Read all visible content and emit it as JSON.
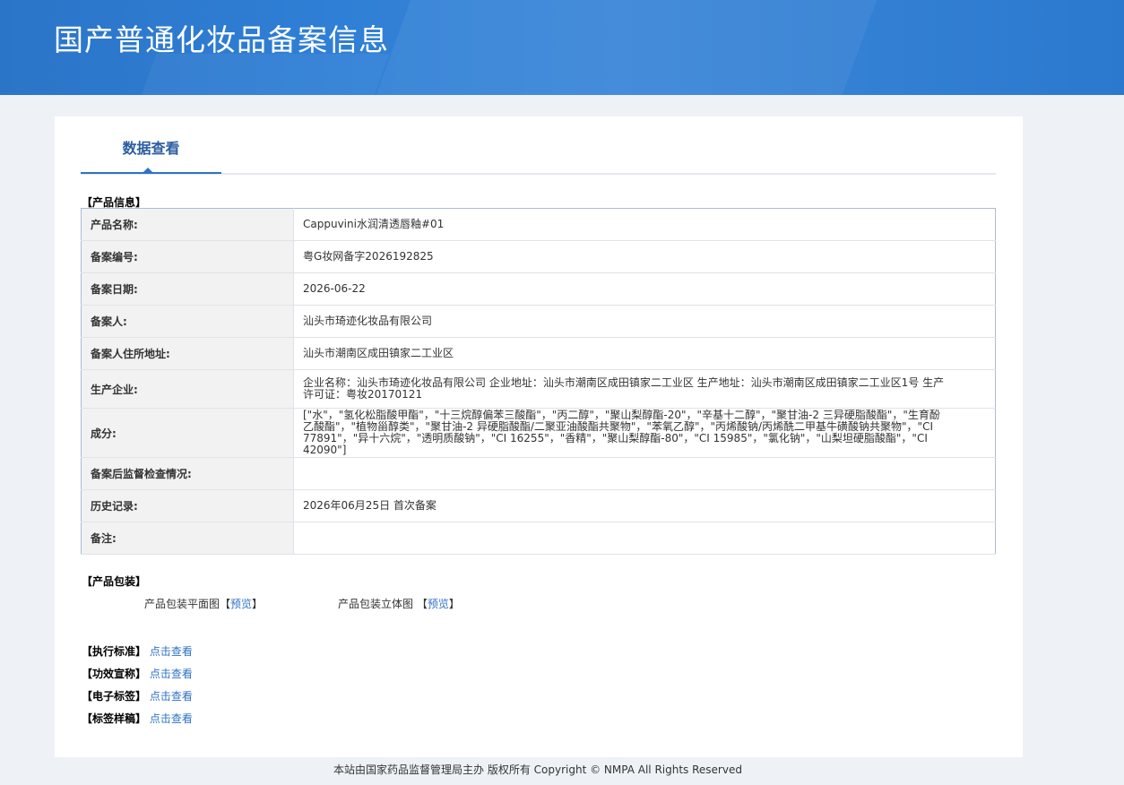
{
  "header": {
    "title": "国产普通化妆品备案信息"
  },
  "tab": {
    "label": "数据查看"
  },
  "product_info": {
    "section_title": "【产品信息】",
    "rows": [
      {
        "label": "产品名称:",
        "value": "Cappuvini水润清透唇釉#01"
      },
      {
        "label": "备案编号:",
        "value": "粤G妆网备字2026192825"
      },
      {
        "label": "备案日期:",
        "value": "2026-06-22"
      },
      {
        "label": "备案人:",
        "value": "汕头市琦迹化妆品有限公司"
      },
      {
        "label": "备案人住所地址:",
        "value": "汕头市潮南区成田镇家二工业区"
      },
      {
        "label": "生产企业:",
        "value": "企业名称：汕头市琦迹化妆品有限公司 企业地址：汕头市潮南区成田镇家二工业区 生产地址：汕头市潮南区成田镇家二工业区1号 生产许可证：粤妆20170121"
      },
      {
        "label": "成分:",
        "value": "[\"水\"，\"氢化松脂酸甲酯\"，\"十三烷醇偏苯三酸酯\"，\"丙二醇\"，\"聚山梨醇酯-20\"，\"辛基十二醇\"，\"聚甘油-2 三异硬脂酸酯\"，\"生育酚乙酸酯\"，\"植物甾醇类\"，\"聚甘油-2 异硬脂酸酯/二聚亚油酸酯共聚物\"，\"苯氧乙醇\"，\"丙烯酸钠/丙烯酰二甲基牛磺酸钠共聚物\"，\"CI 77891\"，\"异十六烷\"，\"透明质酸钠\"，\"CI 16255\"，\"香精\"，\"聚山梨醇酯-80\"，\"CI 15985\"，\"氯化钠\"，\"山梨坦硬脂酸酯\"，\"CI 42090\"]"
      },
      {
        "label": "备案后监督检查情况:",
        "value": ""
      },
      {
        "label": "历史记录:",
        "value": "2026年06月25日 首次备案"
      },
      {
        "label": "备注:",
        "value": ""
      }
    ]
  },
  "packaging": {
    "section_title": "【产品包装】",
    "flat_label": "产品包装平面图【",
    "flat_link": "预览",
    "flat_close": "】",
    "solid_label": "产品包装立体图 【",
    "solid_link": "预览",
    "solid_close": "】"
  },
  "links": [
    {
      "label": "【执行标准】",
      "link": "点击查看"
    },
    {
      "label": "【功效宣称】",
      "link": "点击查看"
    },
    {
      "label": "【电子标签】",
      "link": "点击查看"
    },
    {
      "label": "【标签样稿】",
      "link": "点击查看"
    }
  ],
  "footer": {
    "text": "本站由国家药品监督管理局主办 版权所有 Copyright © NMPA All Rights Reserved"
  },
  "colors": {
    "header": "#2f7fd6",
    "accent": "#2f73c6",
    "label_bg": "#f2f2f2"
  }
}
